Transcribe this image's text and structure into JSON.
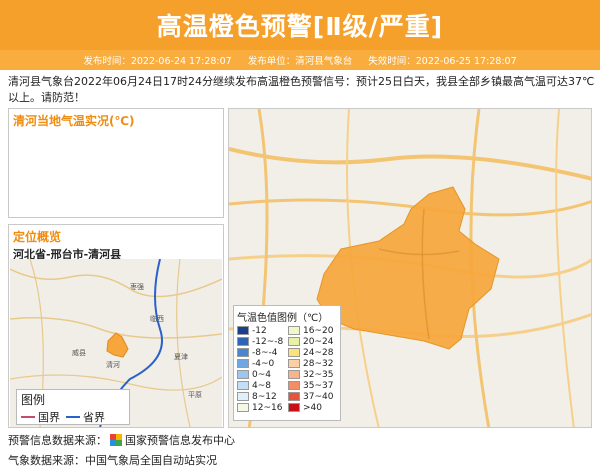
{
  "header": {
    "title": "高温橙色预警[Ⅱ级/严重]",
    "publish_time_label": "发布时间：2022-06-24 17:28:07",
    "publisher_label": "发布单位：清河县气象台",
    "expire_label": "失效时间：2022-06-25 17:28:07"
  },
  "description": "清河县气象台2022年06月24日17时24分继续发布高温橙色预警信号：预计25日白天，我县全部乡镇最高气温可达37℃以上。请防范！",
  "temp_panel": {
    "title": "清河当地气温实况(℃)"
  },
  "location_panel": {
    "title": "定位概览",
    "path": "河北省-邢台市-清河县",
    "legend": {
      "title": "图例",
      "items": [
        {
          "label": "国界",
          "color": "#c0506a"
        },
        {
          "label": "省界",
          "color": "#2a62c9"
        }
      ]
    },
    "place_labels": [
      "威县",
      "临西",
      "清河",
      "夏津",
      "平原",
      "枣强"
    ]
  },
  "temp_legend": {
    "title": "气温色值图例（℃）",
    "items": [
      {
        "label": "-12",
        "color": "#1b3f8f"
      },
      {
        "label": "16~20",
        "color": "#f2f7c9"
      },
      {
        "label": "-12~-8",
        "color": "#2f63b4"
      },
      {
        "label": "20~24",
        "color": "#e8f2a4"
      },
      {
        "label": "-8~-4",
        "color": "#4a85d0"
      },
      {
        "label": "24~28",
        "color": "#fbe27a"
      },
      {
        "label": "-4~0",
        "color": "#6fa7e4"
      },
      {
        "label": "28~32",
        "color": "#fbd0a3"
      },
      {
        "label": "0~4",
        "color": "#9dc7ef"
      },
      {
        "label": "32~35",
        "color": "#f9b489"
      },
      {
        "label": "4~8",
        "color": "#c3def5"
      },
      {
        "label": "35~37",
        "color": "#f38e63"
      },
      {
        "label": "8~12",
        "color": "#e2f0fb"
      },
      {
        "label": "37~40",
        "color": "#e8533a"
      },
      {
        "label": "12~16",
        "color": "#f3f9e4"
      },
      {
        "label": ">40",
        "color": "#c8101a"
      }
    ]
  },
  "sources": {
    "warning_prefix": "预警信息数据来源：",
    "warning_name": "国家预警信息发布中心",
    "weather": "气象数据来源：中国气象局全国自动站实况"
  },
  "colors": {
    "banner": "#f5a02a",
    "meta_bar": "#f8ad3e",
    "warning_area": "#f6a63a",
    "title_accent": "#f08c10"
  },
  "icons": {
    "source_logo": "cma-warning-logo-icon"
  }
}
